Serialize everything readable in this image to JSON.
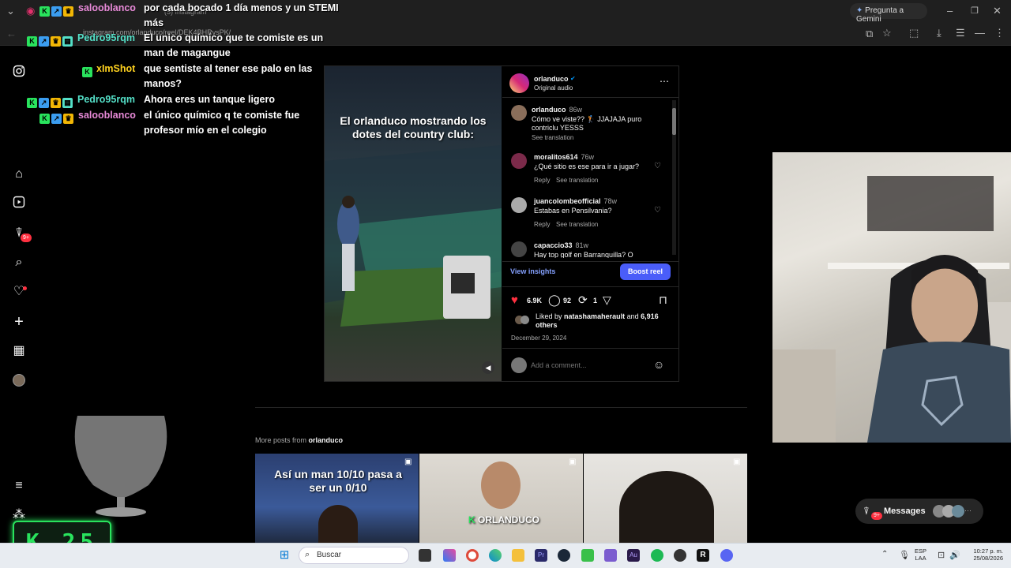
{
  "browser": {
    "tab_title": "(5) Instagram",
    "url": "instagram.com/orlanduco/reel/DEK4BHRvsPK/",
    "gemini_button": "Pregunta a Gemini"
  },
  "chat": [
    {
      "user": "salooblanco",
      "user_color": "#e88ad8",
      "message": "por cada bocado 1 día menos y un STEMI más"
    },
    {
      "user": "Pedro95rqm",
      "user_color": "#54e0c8",
      "message": "El unico químico que te comiste es un man de magangue"
    },
    {
      "user": "xImShot",
      "user_color": "#ffd21f",
      "message": "que sentiste al tener ese palo en las manos?"
    },
    {
      "user": "Pedro95rqm",
      "user_color": "#54e0c8",
      "message": "Ahora eres un tanque ligero"
    },
    {
      "user": "salooblanco",
      "user_color": "#e88ad8",
      "message": "el único químico q te comiste fue profesor mío en el colegio"
    }
  ],
  "sidebar": {
    "icons": [
      "instagram-icon",
      "home-icon",
      "reels-icon",
      "messages-icon",
      "search-icon",
      "notifications-icon",
      "create-icon",
      "dashboard-icon",
      "profile-icon",
      "menu-icon",
      "apps-icon"
    ],
    "messages_badge": "9+"
  },
  "reel": {
    "caption": "El orlanduco mostrando los dotes del country club:",
    "author": "orlanduco",
    "audio": "Original audio",
    "comments": [
      {
        "user": "orlanduco",
        "time": "86w",
        "text": "Cómo ve viste?? 🏌️ JJAJAJA puro contriclu YESSS",
        "meta": "See translation"
      },
      {
        "user": "moralitos614",
        "time": "76w",
        "text": "¿Qué sitio es ese para ir a jugar?",
        "reply": "Reply",
        "translate": "See translation"
      },
      {
        "user": "juancolombeofficial",
        "time": "78w",
        "text": "Estabas en Pensilvania?",
        "reply": "Reply",
        "translate": "See translation"
      },
      {
        "user": "capaccio33",
        "time": "81w",
        "text": "Hay top golf en Barranquilla? O"
      }
    ],
    "view_insights": "View insights",
    "boost_label": "Boost reel",
    "likes": "6.9K",
    "comment_count": "92",
    "reposts": "1",
    "liked_by_prefix": "Liked by",
    "liked_by_user": "natashamaherault",
    "liked_by_and": "and",
    "liked_by_others": "6,916 others",
    "date": "December 29, 2024",
    "add_comment_placeholder": "Add a comment..."
  },
  "more_posts": {
    "prefix": "More posts from",
    "user": "orlanduco",
    "thumbs": [
      {
        "caption": "Así un man 10/10 pasa a ser un 0/10"
      },
      {
        "caption": "ORLANDUCO"
      },
      {
        "caption": ""
      }
    ]
  },
  "messages_pill": {
    "label": "Messages",
    "badge": "9+"
  },
  "taskbar": {
    "search_placeholder": "Buscar",
    "lang_top": "ESP",
    "lang_bottom": "LAA",
    "time": "10:27 p. m.",
    "date": "25/08/2026"
  },
  "counter": {
    "letter": "K",
    "value": "25"
  },
  "colors": {
    "boost": "#4a5df9",
    "like": "#ff3040",
    "accent_green": "#29e35d"
  }
}
